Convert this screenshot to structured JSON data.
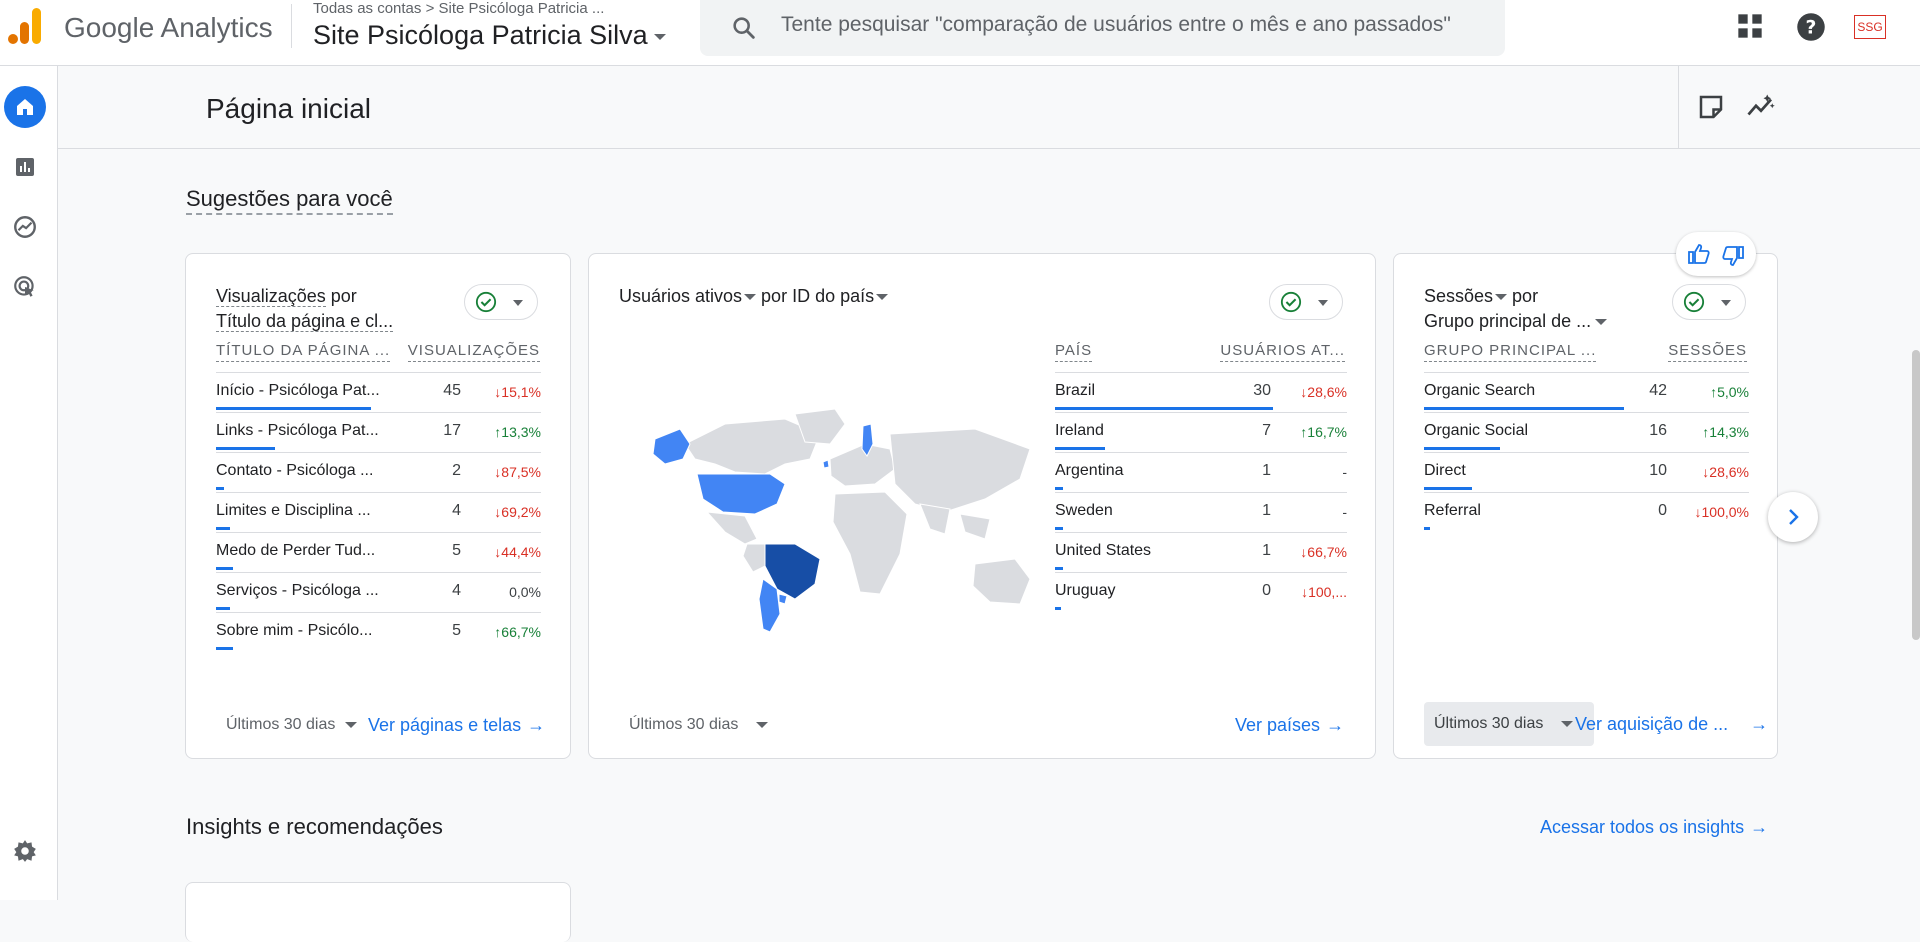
{
  "topbar": {
    "brand": "Google Analytics",
    "breadcrumb": "Todas as contas > Site Psicóloga Patricia ...",
    "property": "Site Psicóloga Patricia Silva",
    "search_placeholder": "Tente pesquisar \"comparação de usuários entre o mês e ano passados\"",
    "avatar": "SSG",
    "icons": [
      "apps-grid-icon",
      "help-icon"
    ]
  },
  "nav": {
    "items": [
      "home-icon",
      "reports-icon",
      "explore-icon",
      "advertising-icon",
      "settings-icon"
    ]
  },
  "page": {
    "title": "Página inicial",
    "suggestions_title": "Sugestões para você",
    "insights_title": "Insights e recomendações",
    "insights_link": "Acessar todos os insights"
  },
  "cards": {
    "pages": {
      "title_a": "Visualizações",
      "title_b": " por",
      "title_c": "Título da página e cl...",
      "col1": "TÍTULO DA PÁGINA ...",
      "col2": "VISUALIZAÇÕES",
      "rows": [
        {
          "label": "Início - Psicóloga Pat...",
          "value": "45",
          "change": "15,1%",
          "dir": "down",
          "bar": 1.0
        },
        {
          "label": "Links - Psicóloga Pat...",
          "value": "17",
          "change": "13,3%",
          "dir": "up",
          "bar": 0.38
        },
        {
          "label": "Contato - Psicóloga ...",
          "value": "2",
          "change": "87,5%",
          "dir": "down",
          "bar": 0.05
        },
        {
          "label": "Limites e Disciplina ...",
          "value": "4",
          "change": "69,2%",
          "dir": "down",
          "bar": 0.09
        },
        {
          "label": "Medo de Perder Tud...",
          "value": "5",
          "change": "44,4%",
          "dir": "down",
          "bar": 0.11
        },
        {
          "label": "Serviços - Psicóloga ...",
          "value": "4",
          "change": "0,0%",
          "dir": "neutral",
          "bar": 0.09
        },
        {
          "label": "Sobre mim - Psicólo...",
          "value": "5",
          "change": "66,7%",
          "dir": "up",
          "bar": 0.11
        }
      ],
      "date": "Últimos 30 dias",
      "link": "Ver páginas e telas"
    },
    "countries": {
      "title_a": "Usuários ativos",
      "title_b": " por ID do país",
      "col1": "PAÍS",
      "col2": "USUÁRIOS AT...",
      "rows": [
        {
          "label": "Brazil",
          "value": "30",
          "change": "28,6%",
          "dir": "down",
          "bar": 1.0
        },
        {
          "label": "Ireland",
          "value": "7",
          "change": "16,7%",
          "dir": "up",
          "bar": 0.23
        },
        {
          "label": "Argentina",
          "value": "1",
          "change": "-",
          "dir": "neutral",
          "bar": 0.03
        },
        {
          "label": "Sweden",
          "value": "1",
          "change": "-",
          "dir": "neutral",
          "bar": 0.03
        },
        {
          "label": "United States",
          "value": "1",
          "change": "66,7%",
          "dir": "down",
          "bar": 0.03
        },
        {
          "label": "Uruguay",
          "value": "0",
          "change": "100,...",
          "dir": "down",
          "bar": 0.0
        }
      ],
      "date": "Últimos 30 dias",
      "link": "Ver países"
    },
    "sessions": {
      "title_a": "Sessões",
      "title_b": " por",
      "title_c": "Grupo principal de ...",
      "col1": "GRUPO PRINCIPAL ...",
      "col2": "SESSÕES",
      "rows": [
        {
          "label": "Organic Search",
          "value": "42",
          "change": "5,0%",
          "dir": "up",
          "bar": 1.0
        },
        {
          "label": "Organic Social",
          "value": "16",
          "change": "14,3%",
          "dir": "up",
          "bar": 0.38
        },
        {
          "label": "Direct",
          "value": "10",
          "change": "28,6%",
          "dir": "down",
          "bar": 0.24
        },
        {
          "label": "Referral",
          "value": "0",
          "change": "100,0%",
          "dir": "down",
          "bar": 0.0
        }
      ],
      "date": "Últimos 30 dias",
      "link": "Ver aquisição de ..."
    }
  },
  "colors": {
    "accent": "#1a73e8",
    "up": "#188038",
    "down": "#d93025",
    "map_dark": "#174ea6",
    "map_mid": "#4285f4",
    "map_grey": "#dadce0"
  }
}
